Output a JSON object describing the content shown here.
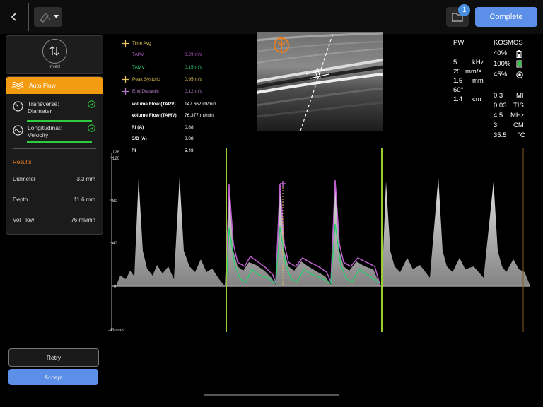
{
  "toolbar": {
    "notification_count": "1",
    "complete_label": "Complete"
  },
  "left_panel": {
    "invert_label": "Invert",
    "auto_flow": {
      "title": "Auto Flow",
      "options": [
        {
          "line1": "Transverse:",
          "line2": "Diameter"
        },
        {
          "line1": "Longitudinal:",
          "line2": "Velocity"
        }
      ]
    },
    "results": {
      "title": "Results",
      "rows": [
        {
          "label": "Diameter",
          "value": "3.3 mm"
        },
        {
          "label": "Depth",
          "value": "11.6 mm"
        },
        {
          "label": "Vol Flow",
          "value": "76 ml/min"
        }
      ]
    },
    "retry_label": "Retry",
    "accept_label": "Accept"
  },
  "measurements": {
    "time_avg": "Time Avg",
    "tapv_label": "TAPV",
    "tapv_value": "0.29 m/s",
    "tamv_label": "TAMV",
    "tamv_value": "0.15 m/s",
    "peak_systolic_label": "Peak Systolic",
    "peak_systolic_value": "0.95 m/s",
    "end_diastolic_label": "End Diastolic",
    "end_diastolic_value": "0.12 m/s",
    "rows": [
      {
        "label": "Volume Flow (TAPV)",
        "value": "147.662 ml/min"
      },
      {
        "label": "Volume Flow (TAMV)",
        "value": "76.377 ml/min"
      },
      {
        "label": "RI (A)",
        "value": "0.88"
      },
      {
        "label": "S/D (A)",
        "value": "8.08"
      },
      {
        "label": "PI",
        "value": "5.48"
      }
    ]
  },
  "acq_params": {
    "mode": "PW",
    "left": [
      "5",
      "25",
      "1.5",
      "60°",
      "1.4"
    ],
    "units": [
      "kHz",
      "mm/s",
      "mm",
      "",
      "cm"
    ],
    "device": "KOSMOS",
    "indicators": [
      "40%",
      "100%",
      "45%"
    ],
    "right_values": [
      "0.3",
      "0.03",
      "4.5",
      "3",
      "35.5"
    ],
    "right_units": [
      "MI",
      "TIS",
      "MHz",
      "CM",
      "°C"
    ]
  },
  "spectrum": {
    "scale_top": "128",
    "ticks": [
      "120",
      "80",
      "40",
      "0"
    ],
    "scale_bottom": "-43 cm/s"
  },
  "colors": {
    "accent": "#f39c12",
    "primary_button": "#5b8fe8",
    "tapv": "#c060d0",
    "tamv": "#2ecc71",
    "marker_green": "#9acd32"
  }
}
